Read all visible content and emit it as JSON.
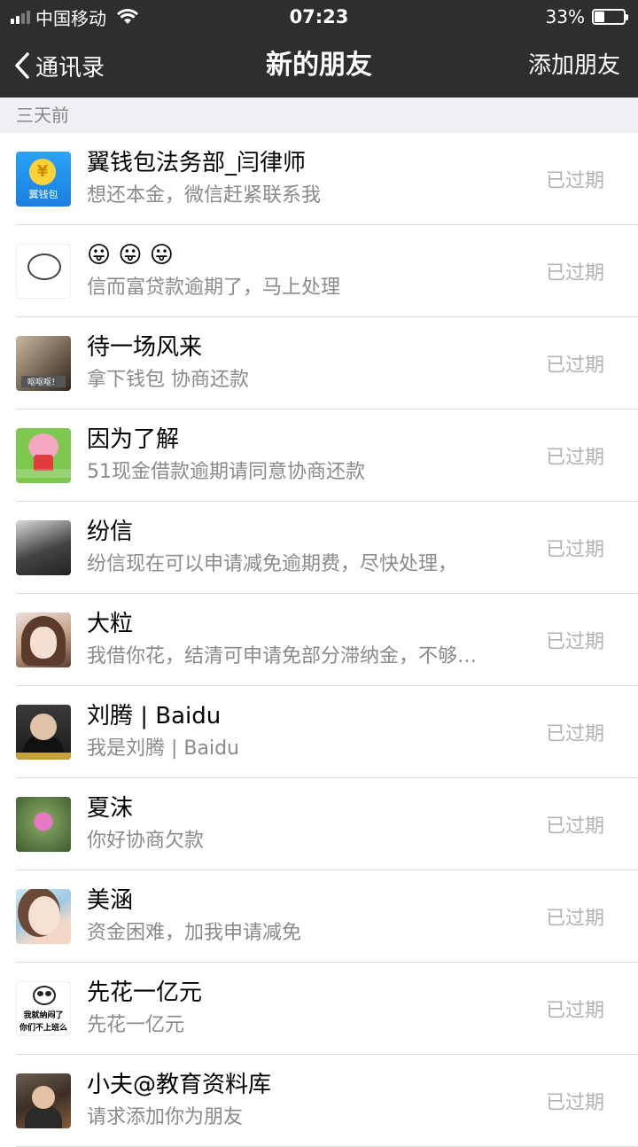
{
  "status_bar": {
    "carrier": "中国移动",
    "time": "07:23",
    "battery": "33%",
    "battery_level": 0.33
  },
  "nav": {
    "back_label": "通讯录",
    "title": "新的朋友",
    "action_label": "添加朋友"
  },
  "section": {
    "label": "三天前"
  },
  "requests": [
    {
      "name": "翼钱包法务部_闫律师",
      "message": "想还本金，微信赶紧联系我",
      "status": "已过期",
      "avatar": "wallet-logo"
    },
    {
      "name": "😛 😛 😛",
      "message": "信而富贷款逾期了，马上处理",
      "status": "已过期",
      "avatar": "sketch-character"
    },
    {
      "name": "待一场风来",
      "message": "拿下钱包 协商还款",
      "status": "已过期",
      "avatar": "cat-photo"
    },
    {
      "name": "因为了解",
      "message": "51现金借款逾期请同意协商还款",
      "status": "已过期",
      "avatar": "peppa-pig"
    },
    {
      "name": "纷信",
      "message": "纷信现在可以申请减免逾期费，尽快处理，",
      "status": "已过期",
      "avatar": "person-photo"
    },
    {
      "name": "大粒",
      "message": "我借你花，结清可申请免部分滞纳金，不够…",
      "status": "已过期",
      "avatar": "girl-photo"
    },
    {
      "name": "刘腾 | Baidu",
      "message": "我是刘腾 | Baidu",
      "status": "已过期",
      "avatar": "man-in-suit"
    },
    {
      "name": "夏沫",
      "message": "你好协商欠款",
      "status": "已过期",
      "avatar": "pink-flower"
    },
    {
      "name": "美涵",
      "message": "资金困难，加我申请减免",
      "status": "已过期",
      "avatar": "girl-selfie"
    },
    {
      "name": "先花一亿元",
      "message": "先花一亿元",
      "status": "已过期",
      "avatar": "panda-meme"
    },
    {
      "name": "小夫@教育资料库",
      "message": "请求添加你为朋友",
      "status": "已过期",
      "avatar": "man-photo"
    }
  ],
  "avatar_text": {
    "wallet_symbol": "¥",
    "wallet_label": "翼钱包",
    "cat_caption": "呕呕呕！",
    "panda_line1": "我就纳闷了",
    "panda_line2": "你们不上班么"
  },
  "colors": {
    "header_bg": "#2e2e30",
    "page_bg": "#efeff4",
    "status_text": "#b2b2b2"
  }
}
